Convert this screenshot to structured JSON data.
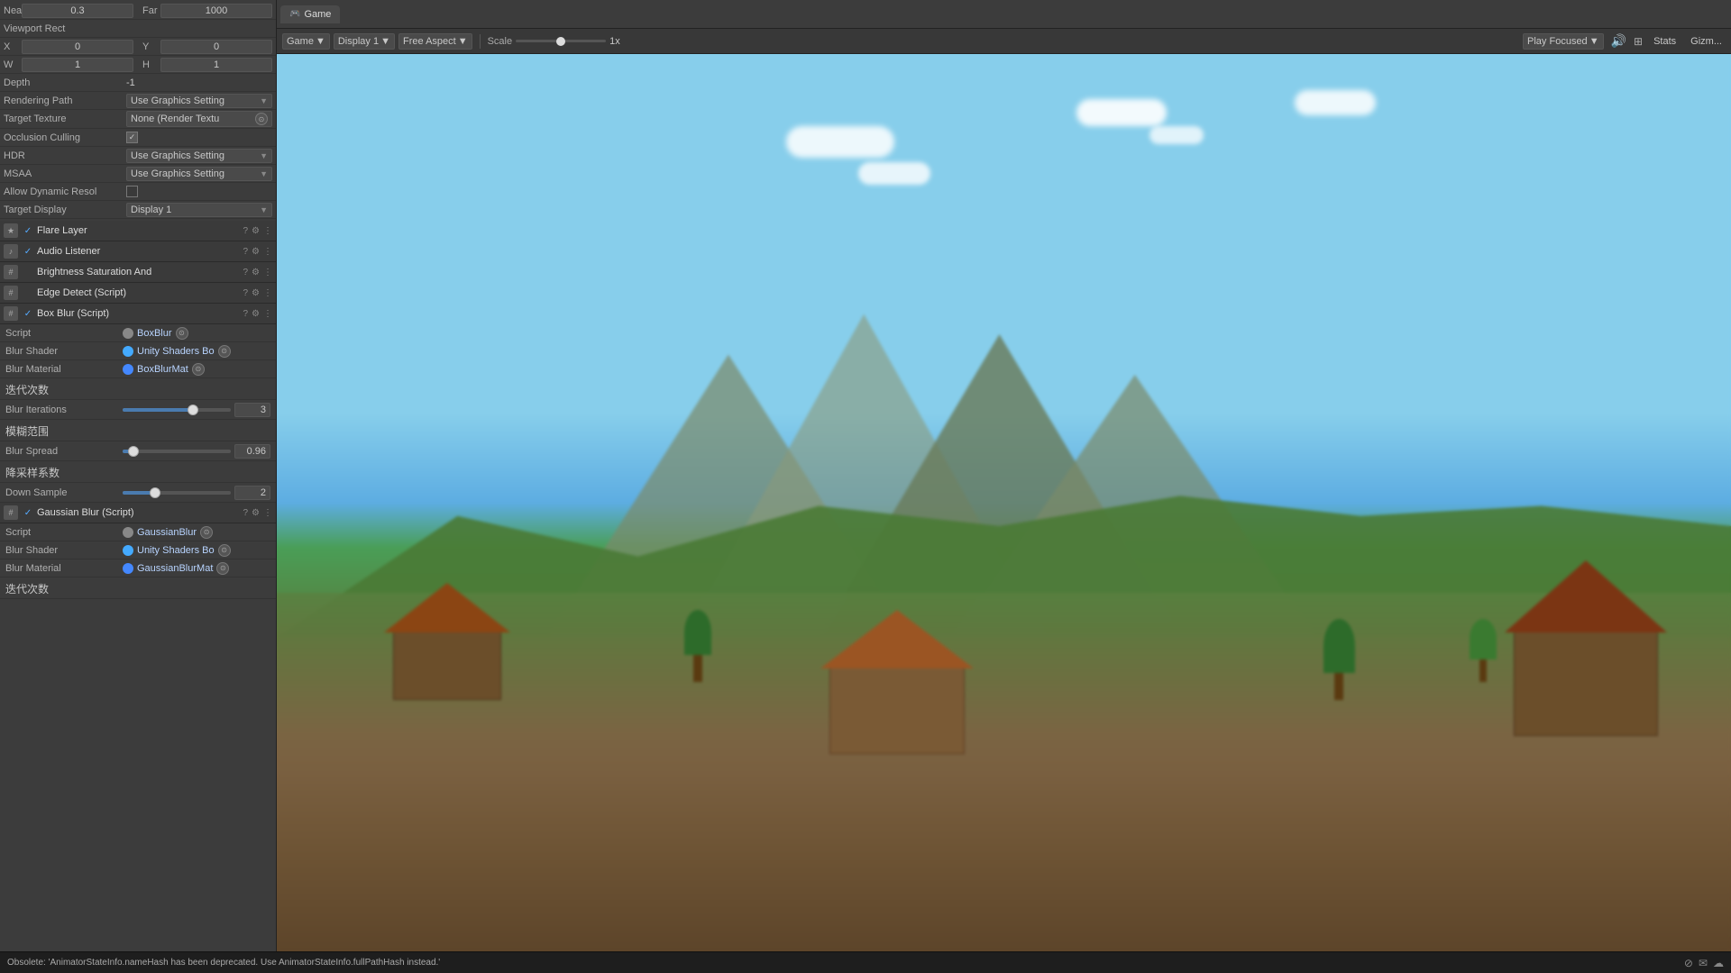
{
  "leftPanel": {
    "clipping": {
      "near_label": "Near",
      "near_val": "0.3",
      "far_label": "Far",
      "far_val": "1000"
    },
    "viewportRect": {
      "label": "Viewport Rect",
      "x_label": "X",
      "x_val": "0",
      "y_label": "Y",
      "y_val": "0",
      "w_label": "W",
      "w_val": "1",
      "h_label": "H",
      "h_val": "1"
    },
    "depth": {
      "label": "Depth",
      "val": "-1"
    },
    "renderingPath": {
      "label": "Rendering Path",
      "val": "Use Graphics Setting"
    },
    "targetTexture": {
      "label": "Target Texture",
      "val": "None (Render Textu"
    },
    "occlusionCulling": {
      "label": "Occlusion Culling",
      "checked": true
    },
    "hdr": {
      "label": "HDR",
      "val": "Use Graphics Setting"
    },
    "msaa": {
      "label": "MSAA",
      "val": "Use Graphics Setting"
    },
    "allowDynamic": {
      "label": "Allow Dynamic Resol"
    },
    "targetDisplay": {
      "label": "Target Display",
      "val": "Display 1"
    },
    "components": [
      {
        "id": "flare-layer",
        "name": "Flare Layer",
        "checked": true,
        "icon": "★"
      },
      {
        "id": "audio-listener",
        "name": "Audio Listener",
        "checked": true,
        "icon": "♪"
      },
      {
        "id": "brightness",
        "name": "Brightness Saturation And",
        "checked": false,
        "icon": "#"
      },
      {
        "id": "edge-detect",
        "name": "Edge Detect (Script)",
        "checked": false,
        "icon": "#"
      },
      {
        "id": "box-blur",
        "name": "Box Blur (Script)",
        "checked": true,
        "icon": "#"
      }
    ],
    "boxBlur": {
      "script_label": "Script",
      "script_val": "BoxBlur",
      "shader_label": "Blur Shader",
      "shader_val": "Unity Shaders Bo",
      "material_label": "Blur Material",
      "material_val": "BoxBlurMat",
      "section1_cn": "迭代次数",
      "blur_iterations_label": "Blur Iterations",
      "blur_iterations_val": "3",
      "blur_iterations_pct": 65,
      "section2_cn": "模糊范围",
      "blur_spread_label": "Blur Spread",
      "blur_spread_val": "0.96",
      "blur_spread_pct": 10,
      "section3_cn": "降采样系数",
      "down_sample_label": "Down Sample",
      "down_sample_val": "2",
      "down_sample_pct": 30
    },
    "gaussianBlur": {
      "name": "Gaussian Blur (Script)",
      "checked": true,
      "script_label": "Script",
      "script_val": "GaussianBlur",
      "shader_label": "Blur Shader",
      "shader_val": "Unity Shaders Bo",
      "material_label": "Blur Material",
      "material_val": "GaussianBlurMat",
      "section_cn": "迭代次数"
    }
  },
  "gamePanel": {
    "tab_label": "Game",
    "tab_icon": "🎮",
    "toolbar": {
      "game_label": "Game",
      "display_label": "Display 1",
      "aspect_label": "Free Aspect",
      "scale_label": "Scale",
      "scale_val": "1x",
      "play_focused_label": "Play Focused",
      "stats_label": "Stats",
      "gizmos_label": "Gizm..."
    }
  },
  "console": {
    "message": "Obsolete: 'AnimatorStateInfo.nameHash has been deprecated. Use AnimatorStateInfo.fullPathHash instead.'"
  }
}
